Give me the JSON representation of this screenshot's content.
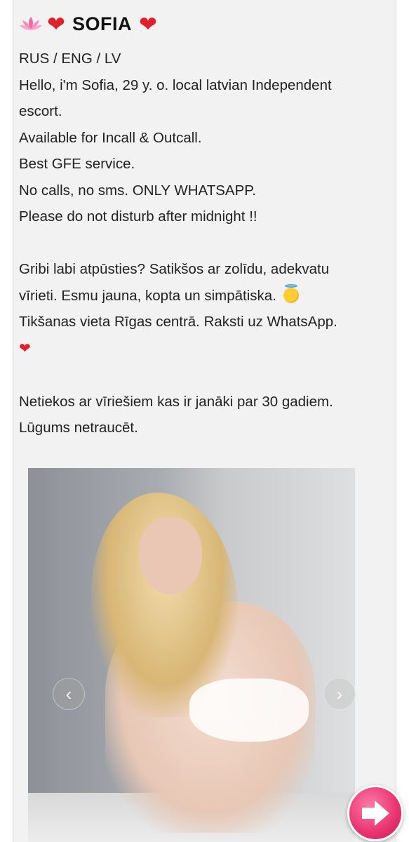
{
  "header": {
    "name": "SOFIA",
    "icons": [
      "lotus-icon",
      "heart-icon",
      "heart-icon"
    ]
  },
  "bio": {
    "line1": "RUS / ENG / LV",
    "line2": "Hello, i'm Sofia, 29 y. o. local latvian Independent escort.",
    "line3": "Available for Incall & Outcall.",
    "line4": "Best GFE service.",
    "line5": "No calls, no sms. ONLY WHATSAPP.",
    "line6": "Please do not disturb after midnight !!",
    "lv_para1": "Gribi labi atpūsties? Satikšos ar zolīdu, adekvatu vīrieti. Esmu jauna, kopta un simpātiska.",
    "lv_para1b": "Tikšanas vieta Rīgas centrā. Raksti uz WhatsApp.",
    "lv_para2": "Netiekos ar vīriešiem kas ir janāki par 30 gadiem. Lūgums netraucēt."
  },
  "gallery": {
    "prev_icon": "chevron-left-icon",
    "next_icon": "chevron-right-icon"
  },
  "fab": {
    "icon": "arrow-right-icon",
    "color": "#e8336f"
  },
  "colors": {
    "heart": "#e0202a",
    "lotus": "#f06aa8",
    "card_bg": "#f2f2f2"
  }
}
